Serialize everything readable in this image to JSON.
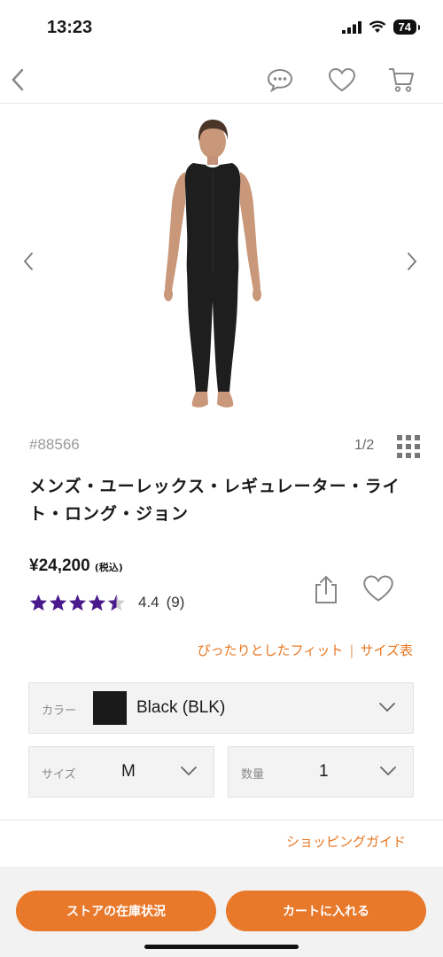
{
  "status_bar": {
    "time": "13:23",
    "battery": "74"
  },
  "nav": {
    "icons": [
      "back-icon",
      "chat-icon",
      "heart-icon",
      "cart-icon"
    ]
  },
  "product": {
    "sku": "#88566",
    "image_page": "1/2",
    "title": "メンズ・ユーレックス・レギュレーター・ライト・ロング・ジョン",
    "price": "¥24,200",
    "tax_label": "(税込)",
    "rating": 4.4,
    "rating_text": "4.4",
    "review_count": "(9)"
  },
  "fit": {
    "fit_label": "ぴったりとしたフィット",
    "separator": "|",
    "size_chart": "サイズ表"
  },
  "options": {
    "color_label": "カラー",
    "color_value": "Black (BLK)",
    "color_swatch": "#1a1a1a",
    "size_label": "サイズ",
    "size_value": "M",
    "qty_label": "数量",
    "qty_value": "1"
  },
  "guide_link": "ショッピングガイド",
  "buttons": {
    "store_stock": "ストアの在庫状況",
    "add_to_cart": "カートに入れる"
  },
  "colors": {
    "accent": "#e87722",
    "star": "#4a1a8c"
  }
}
